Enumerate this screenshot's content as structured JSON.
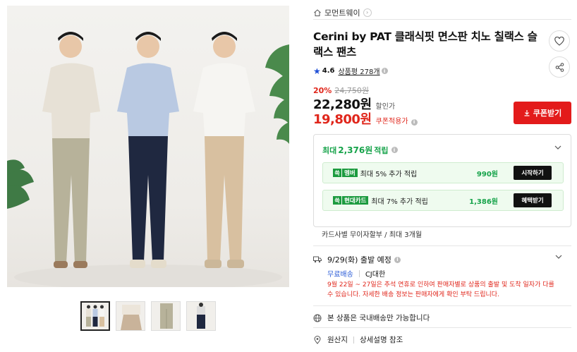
{
  "brand": {
    "name": "모먼트웨이"
  },
  "product": {
    "title": "Cerini by PAT 클래식핏 면스판 치노 칠랙스 슬랙스 팬츠",
    "rating": "4.6",
    "review_label": "상품평 278개"
  },
  "price": {
    "discount_rate": "20%",
    "original": "24,750원",
    "sale": "22,280원",
    "sale_label": "할인가",
    "coupon": "19,800원",
    "coupon_label": "쿠폰적용가",
    "coupon_button": "쿠폰받기"
  },
  "reward": {
    "prefix": "최대",
    "amount": "2,376원",
    "suffix": "적립",
    "cards": [
      {
        "logo_mark": "쓱",
        "logo_name": "멤버",
        "desc": "최대 5% 추가 적립",
        "amount": "990원",
        "button": "시작하기"
      },
      {
        "logo_mark": "쓱",
        "logo_name": "현대카드",
        "desc": "최대 7% 추가 적립",
        "amount": "1,386원",
        "button": "혜택받기"
      }
    ]
  },
  "installment": "카드사별 무이자할부 / 최대 3개월",
  "shipping": {
    "date": "9/29(화) 출발 예정",
    "free": "무료배송",
    "carrier": "CJ대한",
    "notice": "9월 22일 ~ 27일은 추석 연휴로 인하여 판매자별로 상품의 출발 및 도착 일자가 다를 수 있습니다. 자세한 배송 정보는 판매자에게 확인 부탁 드립니다."
  },
  "domestic": "본 상품은 국내배송만 가능합니다",
  "origin": {
    "label": "원산지",
    "value": "상세설명 참조"
  },
  "icons": [
    "home-icon",
    "heart-icon",
    "share-icon",
    "star-icon",
    "info-icon",
    "download-icon",
    "chevron-down-icon",
    "truck-icon",
    "globe-icon",
    "origin-icon"
  ],
  "colors": {
    "accent_red": "#e31b1b",
    "green": "#16a34a",
    "blue": "#2a5bd7"
  }
}
